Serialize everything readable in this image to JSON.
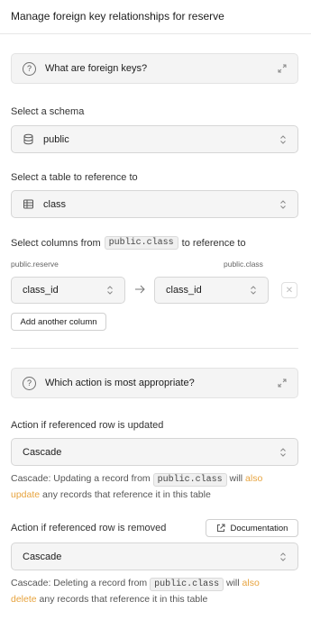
{
  "header": {
    "title": "Manage foreign key relationships for reserve"
  },
  "info_fk": {
    "title": "What are foreign keys?",
    "icon": "help-circle-icon"
  },
  "schema": {
    "label": "Select a schema",
    "value": "public",
    "icon": "database-icon"
  },
  "table": {
    "label": "Select a table to reference to",
    "value": "class",
    "icon": "table-icon"
  },
  "columns": {
    "label_prefix": "Select columns from",
    "label_code": "public.class",
    "label_suffix": "to reference to",
    "source_table": "public.reserve",
    "target_table": "public.class",
    "source_value": "class_id",
    "target_value": "class_id",
    "add_label": "Add another column"
  },
  "info_action": {
    "title": "Which action is most appropriate?"
  },
  "on_update": {
    "label": "Action if referenced row is updated",
    "value": "Cascade",
    "desc_prefix": "Cascade: Updating a record from",
    "desc_code": "public.class",
    "desc_will": "will",
    "desc_hl1": "also",
    "desc_hl2": "update",
    "desc_suffix": "any records that reference it in this table"
  },
  "on_delete": {
    "label": "Action if referenced row is removed",
    "doc_label": "Documentation",
    "value": "Cascade",
    "desc_prefix": "Cascade: Deleting a record from",
    "desc_code": "public.class",
    "desc_will": "will",
    "desc_hl1": "also",
    "desc_hl2": "delete",
    "desc_suffix": "any records that reference it in this table"
  },
  "colors": {
    "highlight": "#e7a33e",
    "panel_bg": "#f4f4f4",
    "border": "#d6d6d6"
  }
}
